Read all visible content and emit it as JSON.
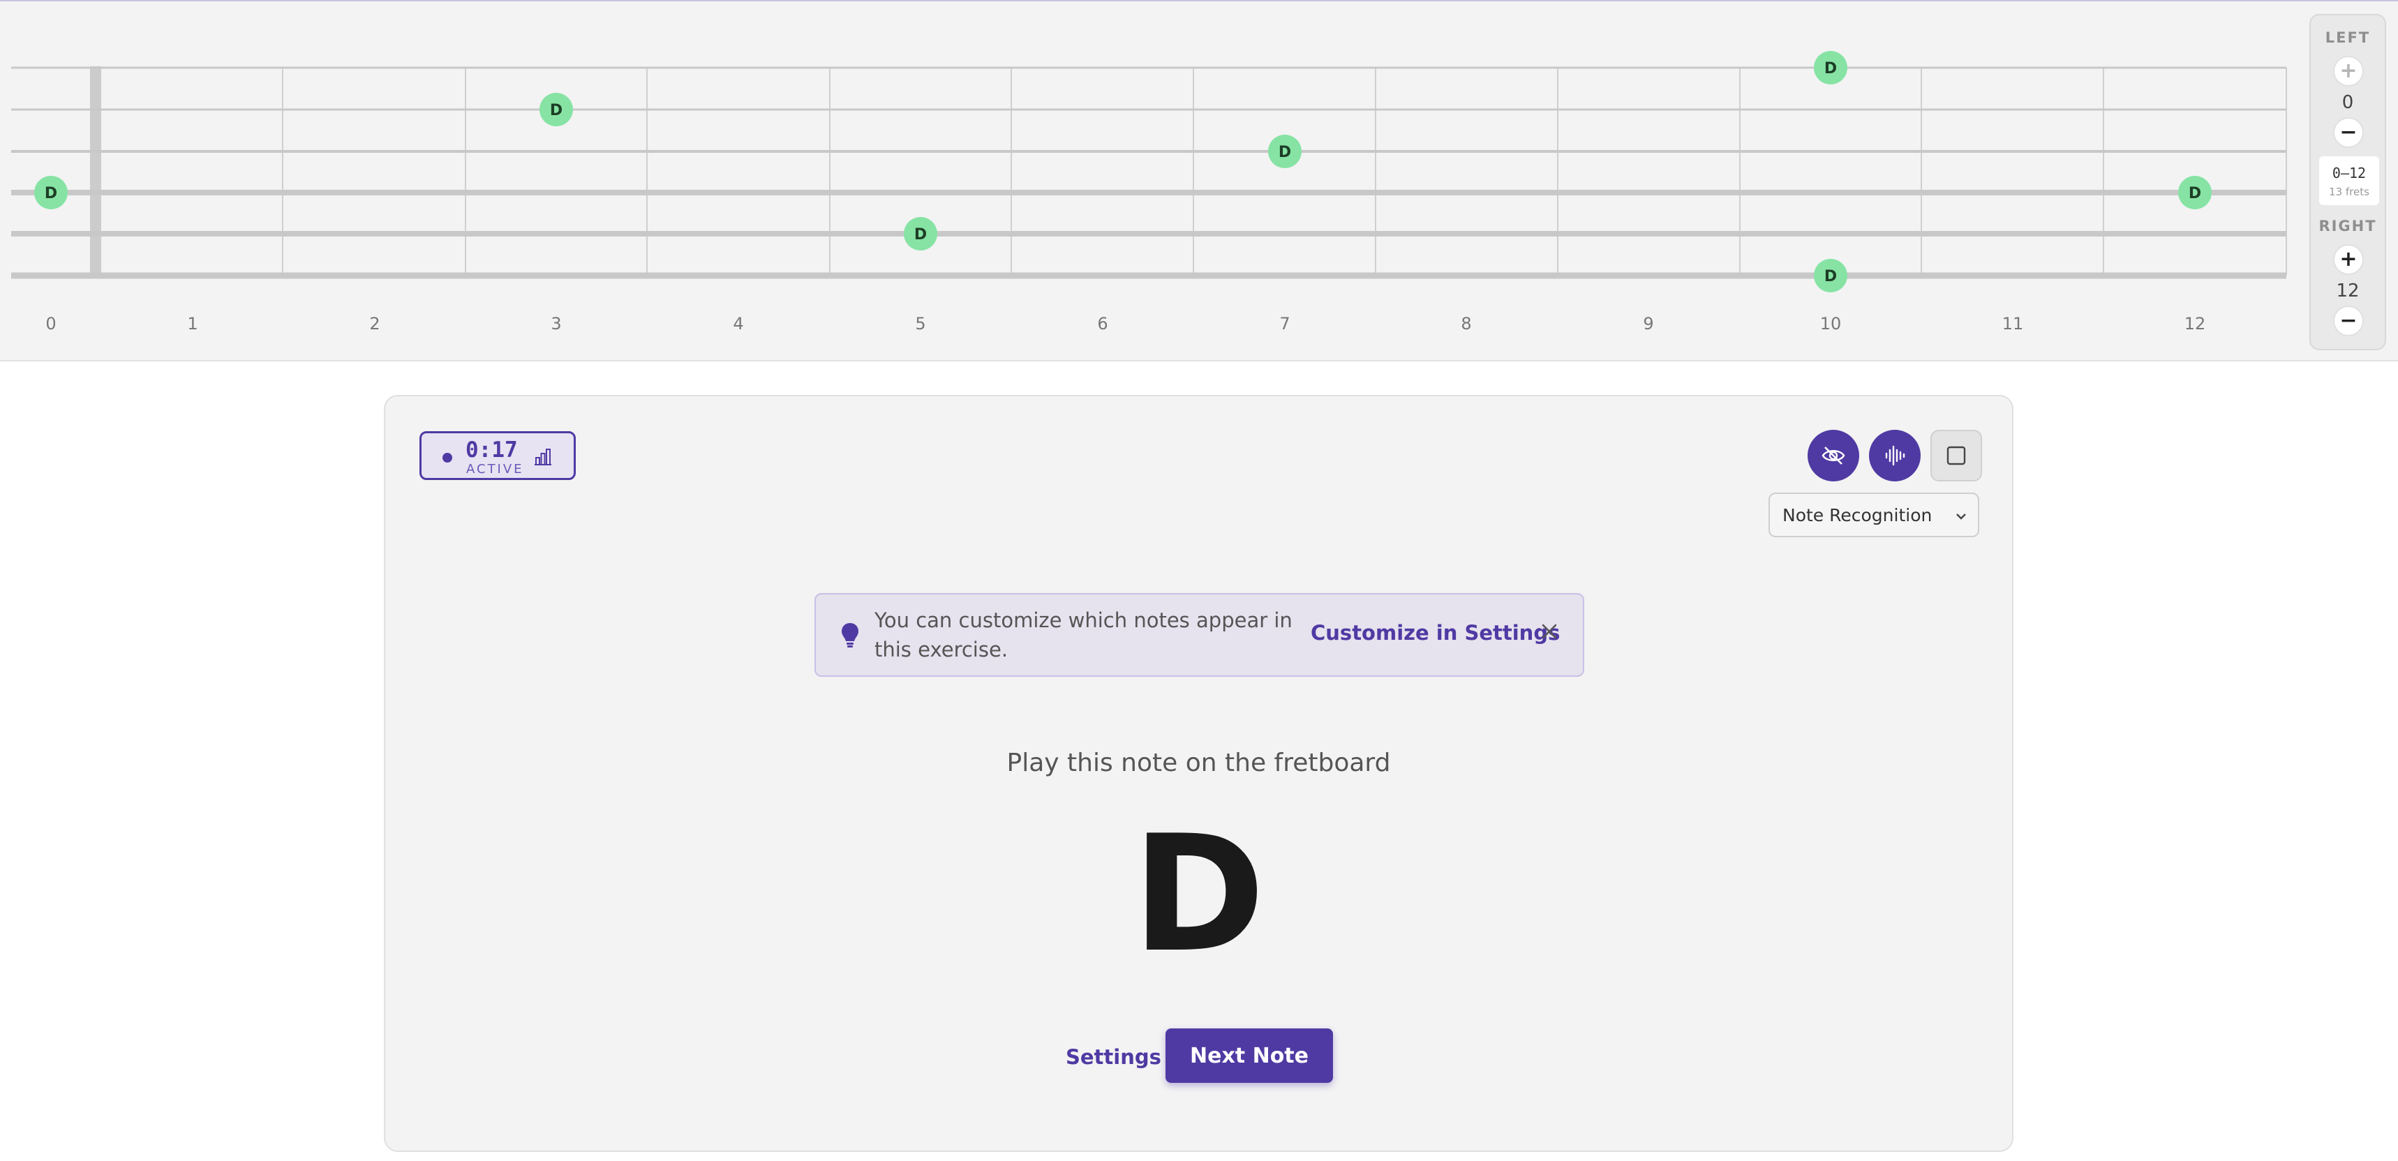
{
  "fretboard": {
    "fret_numbers": [
      "0",
      "1",
      "2",
      "3",
      "4",
      "5",
      "6",
      "7",
      "8",
      "9",
      "10",
      "11",
      "12"
    ],
    "markers": [
      {
        "label": "D",
        "string": 1,
        "fret": 10
      },
      {
        "label": "D",
        "string": 2,
        "fret": 3
      },
      {
        "label": "D",
        "string": 3,
        "fret": 7
      },
      {
        "label": "D",
        "string": 4,
        "fret": 0
      },
      {
        "label": "D",
        "string": 4,
        "fret": 12
      },
      {
        "label": "D",
        "string": 5,
        "fret": 5
      },
      {
        "label": "D",
        "string": 6,
        "fret": 10
      }
    ],
    "marker_color": "#86e3a4"
  },
  "fret_range": {
    "left_label": "LEFT",
    "left_value": "0",
    "range_text": "0–12",
    "range_subtext": "13 frets",
    "right_label": "RIGHT",
    "right_value": "12",
    "plus_symbol": "+",
    "minus_symbol": "−"
  },
  "timer": {
    "time": "0:17",
    "status": "ACTIVE"
  },
  "mode_select": {
    "selected": "Note Recognition"
  },
  "tip": {
    "text": "You can customize which notes appear in this exercise.",
    "link": "Customize in Settings"
  },
  "exercise": {
    "prompt": "Play this note on the fretboard",
    "note": "D",
    "settings_label": "Settings",
    "next_label": "Next Note"
  },
  "colors": {
    "accent": "#4f3aa3",
    "marker": "#86e3a4"
  }
}
